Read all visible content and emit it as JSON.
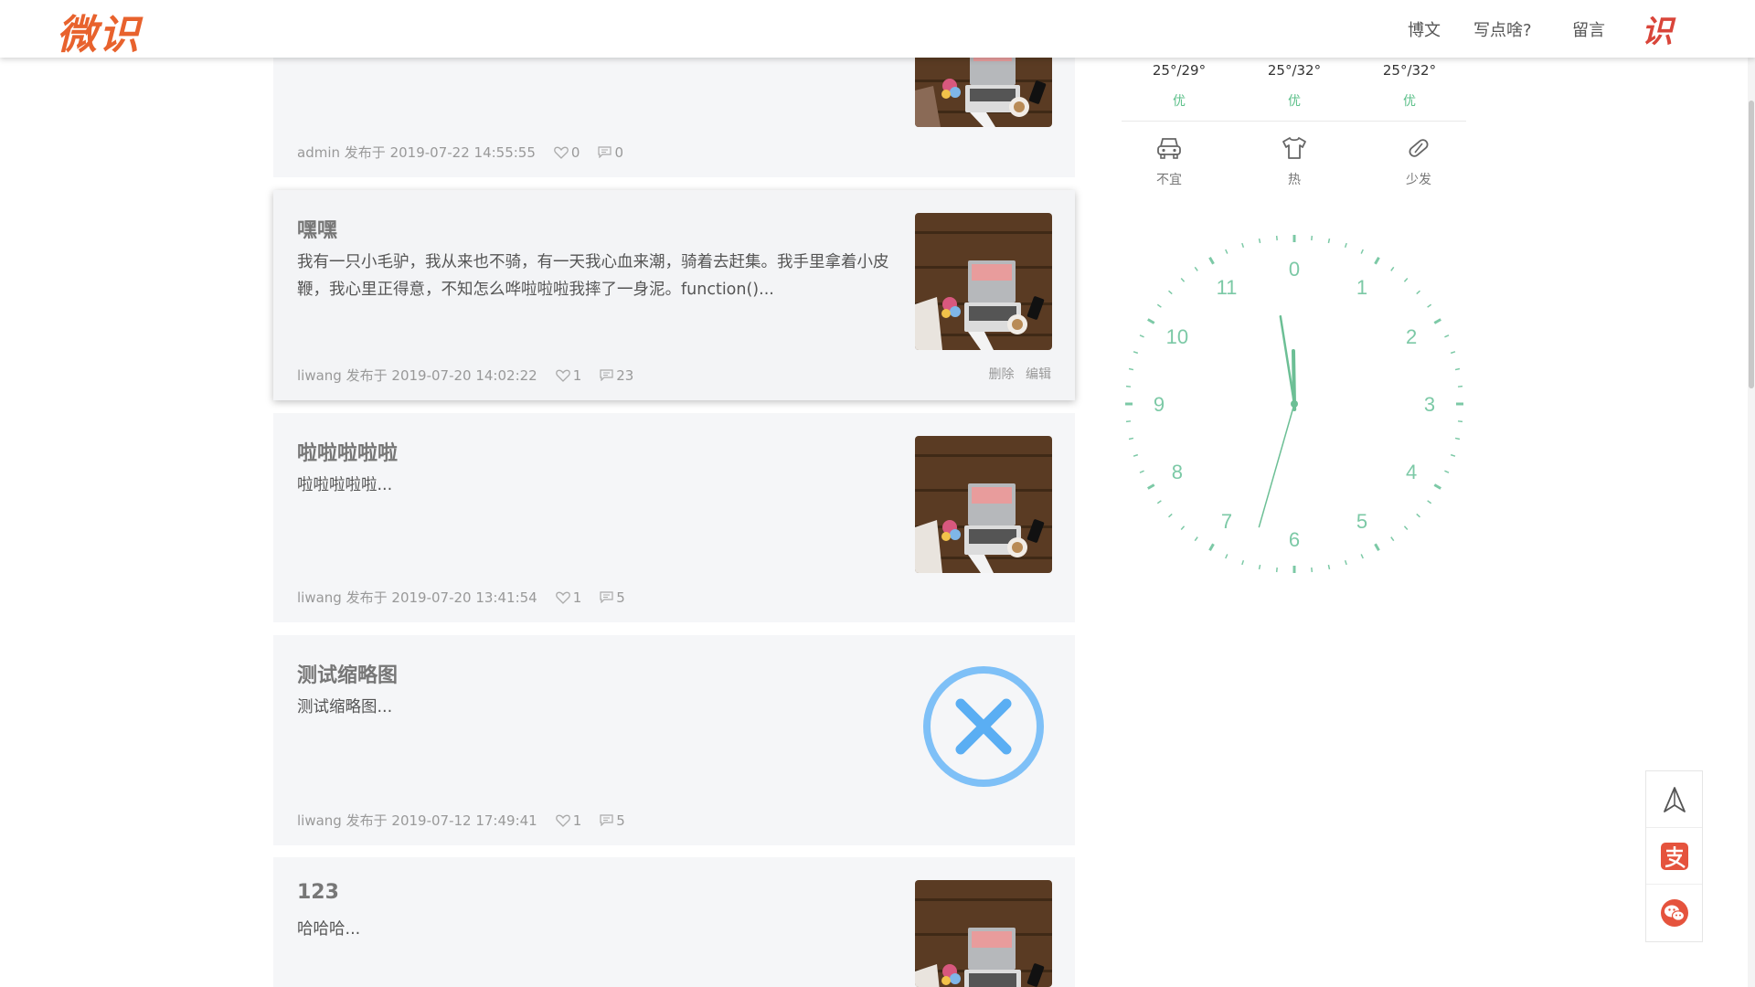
{
  "header": {
    "logo": "微识",
    "nav": [
      "博文",
      "写点啥?",
      "留言"
    ],
    "brand_mini": "识"
  },
  "posts": [
    {
      "title": "",
      "excerpt": "",
      "author": "admin",
      "published_label": "发布于",
      "datetime": "2019-07-22 14:55:55",
      "likes": "0",
      "comments": "0",
      "thumb": "laptop"
    },
    {
      "title": "嘿嘿",
      "excerpt": "我有一只小毛驴，我从来也不骑，有一天我心血来潮，骑着去赶集。我手里拿着小皮鞭，我心里正得意，不知怎么哗啦啦啦我摔了一身泥。function()...",
      "author": "liwang",
      "published_label": "发布于",
      "datetime": "2019-07-20 14:02:22",
      "likes": "1",
      "comments": "23",
      "thumb": "laptop",
      "actions": {
        "delete": "删除",
        "edit": "编辑"
      }
    },
    {
      "title": "啦啦啦啦啦",
      "excerpt": "啦啦啦啦啦...",
      "author": "liwang",
      "published_label": "发布于",
      "datetime": "2019-07-20 13:41:54",
      "likes": "1",
      "comments": "5",
      "thumb": "laptop"
    },
    {
      "title": "测试缩略图",
      "excerpt": "测试缩略图...",
      "author": "liwang",
      "published_label": "发布于",
      "datetime": "2019-07-12 17:49:41",
      "likes": "1",
      "comments": "5",
      "thumb": "broken-x"
    },
    {
      "title": "123",
      "excerpt": "哈哈哈...",
      "author": "",
      "published_label": "",
      "datetime": "",
      "likes": "",
      "comments": "",
      "thumb": "laptop"
    }
  ],
  "weather": {
    "forecast": [
      {
        "temp": "25°/29°",
        "aqi": "优"
      },
      {
        "temp": "25°/32°",
        "aqi": "优"
      },
      {
        "temp": "25°/32°",
        "aqi": "优"
      }
    ],
    "life_index": [
      {
        "icon": "car-icon",
        "label": "不宜"
      },
      {
        "icon": "shirt-icon",
        "label": "热"
      },
      {
        "icon": "pill-icon",
        "label": "少发"
      }
    ]
  },
  "clock": {
    "numbers": [
      "0",
      "1",
      "2",
      "3",
      "4",
      "5",
      "6",
      "7",
      "8",
      "9",
      "10",
      "11"
    ],
    "color": "#7cc9a6"
  },
  "floatbar": [
    "top-arrow-icon",
    "alipay-icon",
    "wechat-icon"
  ],
  "colors": {
    "accent": "#e8622d",
    "green": "#5cc08a",
    "red": "#e5533d"
  }
}
